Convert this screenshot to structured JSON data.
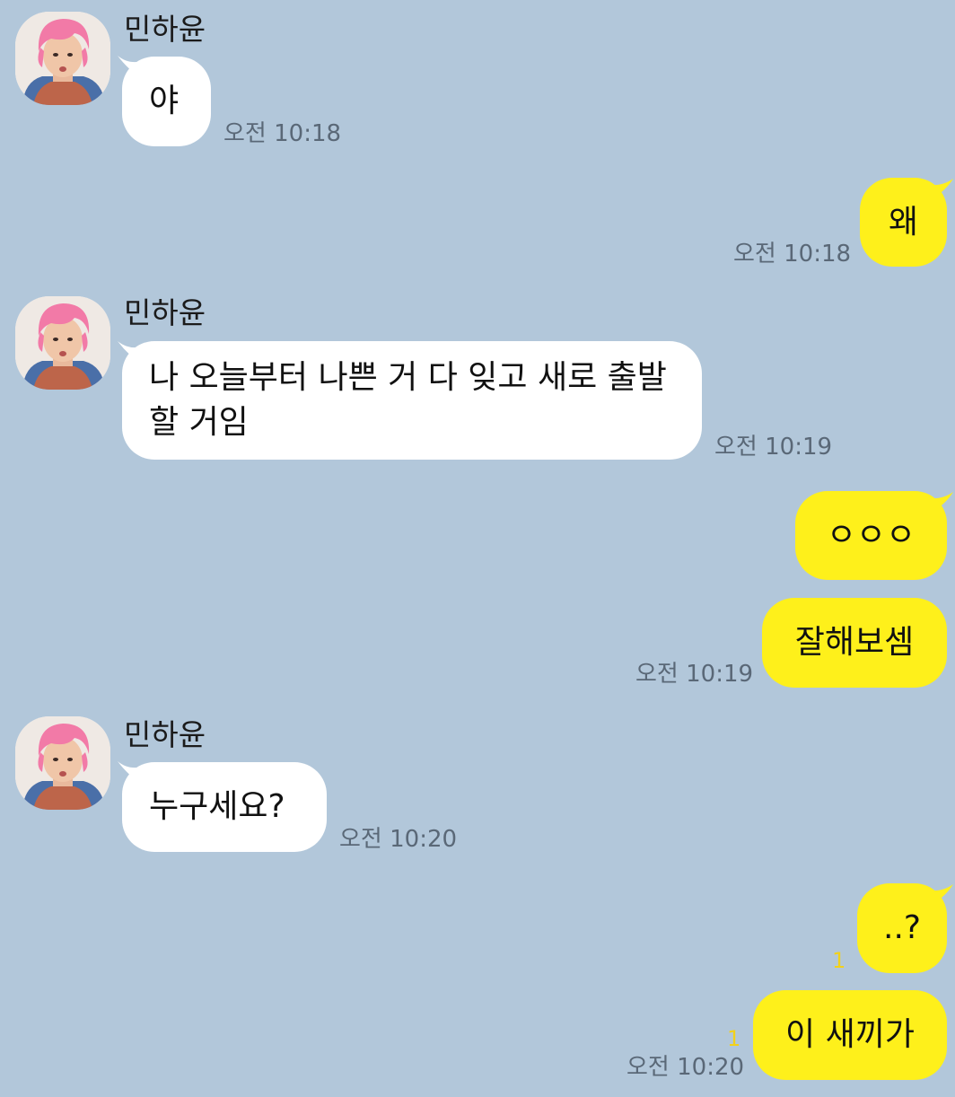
{
  "contact": {
    "name": "민하윤"
  },
  "messages": [
    {
      "text": "야",
      "time": "오전 10:18"
    },
    {
      "text": "왜",
      "time": "오전 10:18"
    },
    {
      "text": "나 오늘부터 나쁜 거 다 잊고 새로 출발 할 거임",
      "time": "오전 10:19"
    },
    {
      "text": "ㅇㅇㅇ"
    },
    {
      "text": "잘해보셈",
      "time": "오전 10:19"
    },
    {
      "text": "누구세요?",
      "time": "오전 10:20"
    },
    {
      "text": "..?",
      "unread": "1"
    },
    {
      "text": "이 새끼가",
      "unread": "1",
      "time": "오전 10:20"
    }
  ],
  "colors": {
    "background": "#b2c7da",
    "incoming_bubble": "#ffffff",
    "outgoing_bubble": "#fef01b",
    "unread_count": "#f2d11a",
    "timestamp": "#5a6877"
  },
  "icons": {
    "avatar": "profile-photo-pink-hair"
  }
}
